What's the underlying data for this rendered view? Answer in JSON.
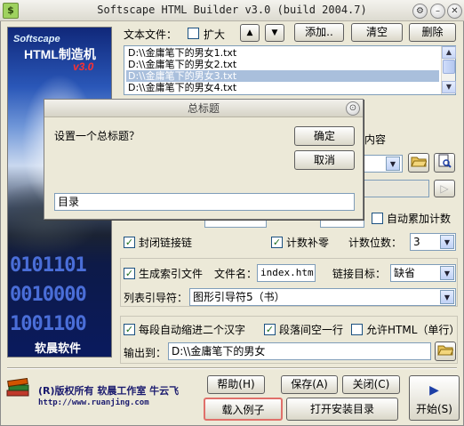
{
  "window": {
    "title": "Softscape HTML Builder v3.0 (build 2004.7)",
    "icon_glyph": "$"
  },
  "titlebar_buttons": [
    {
      "name": "settings",
      "glyph": "⚙"
    },
    {
      "name": "minimize",
      "glyph": "–"
    },
    {
      "name": "close",
      "glyph": "✕"
    }
  ],
  "splash": {
    "brand": "Softscape",
    "name": "HTML制造机",
    "version": "v3.0",
    "digits": [
      "0101101",
      "0010000",
      "1001100"
    ],
    "footer": "软晨软件"
  },
  "files": {
    "label": "文本文件：",
    "expand_label": "扩大",
    "expand_checked": false,
    "up_glyph": "▲",
    "down_glyph": "▼",
    "add_label": "添加..",
    "clear_label": "清空",
    "delete_label": "删除",
    "items": [
      "D:\\\\金庸笔下的男女1.txt",
      "D:\\\\金庸笔下的男女2.txt",
      "D:\\\\金庸笔下的男女3.txt",
      "D:\\\\金庸笔下的男女4.txt"
    ],
    "selected_index": 2
  },
  "dialog": {
    "title": "总标题",
    "prompt": "设置一个总标题？",
    "ok_label": "确定",
    "cancel_label": "取消",
    "input_value": "目录",
    "close_glyph": "⊙"
  },
  "behind": {
    "content_label": "内容"
  },
  "options": {
    "auto_add_count_label": "自动累加计数",
    "auto_add_count_checked": false,
    "close_link_label": "封闭链接链",
    "close_link_checked": true,
    "count_pad_label": "计数补零",
    "count_pad_checked": true,
    "count_digits_label": "计数位数：",
    "count_digits_value": "3",
    "gen_index_label": "生成索引文件",
    "gen_index_checked": true,
    "filename_label": "文件名：",
    "filename_value": "index.htm",
    "link_target_label": "链接目标：",
    "link_target_value": "缺省",
    "list_guide_label": "列表引导符：",
    "list_guide_value": "图形引导符5（书）",
    "indent_label": "每段自动缩进二个汉字",
    "indent_checked": true,
    "para_space_label": "段落间空一行",
    "para_space_checked": true,
    "allow_html_label": "允许HTML（单行）",
    "allow_html_checked": false,
    "output_label": "输出到：",
    "output_value": "D:\\\\金庸笔下的男女"
  },
  "footer": {
    "copyright": "(R)版权所有 软晨工作室 牛云飞",
    "url": "http://www.ruanjing.com",
    "help_label": "帮助(H)",
    "save_label": "保存(A)",
    "close_label": "关闭(C)",
    "load_example_label": "载入例子",
    "open_dir_label": "打开安装目录",
    "start_label": "开始(S)",
    "start_glyph": "▶"
  },
  "colors": {
    "accent": "#1d3fa6",
    "selection": "#a9bfdc",
    "highlight_border": "#e0706a"
  }
}
